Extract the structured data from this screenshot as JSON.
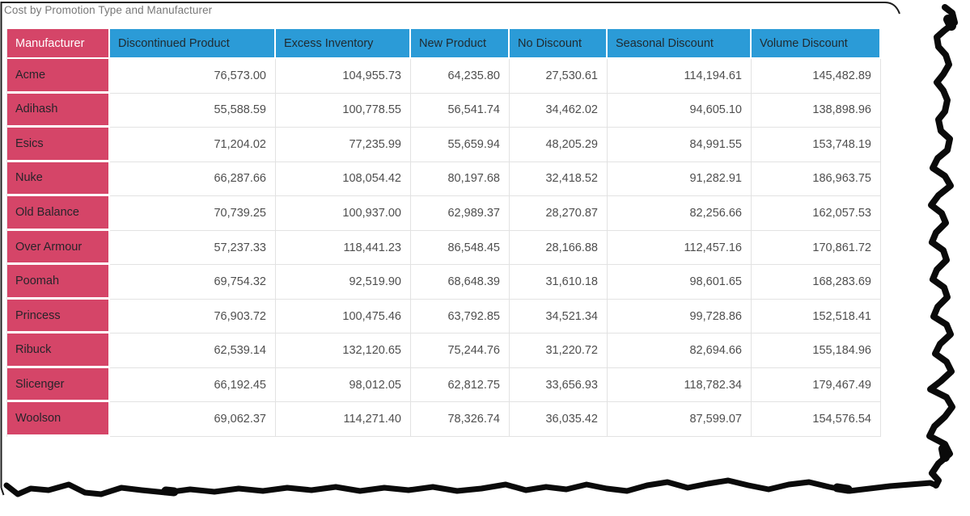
{
  "title": "Cost by Promotion Type and Manufacturer",
  "colors": {
    "header_pink": "#d54568",
    "header_blue": "#2b9bd7",
    "grid_line": "#e2e2e2",
    "title_text": "#787878",
    "value_text": "#4e4e4e",
    "torn_edge": "#0a0a0a"
  },
  "table": {
    "corner_header": "Manufacturer",
    "column_headers": [
      "Discontinued Product",
      "Excess Inventory",
      "New Product",
      "No Discount",
      "Seasonal Discount",
      "Volume Discount"
    ],
    "rows": [
      {
        "manufacturer": "Acme",
        "values": [
          "76,573.00",
          "104,955.73",
          "64,235.80",
          "27,530.61",
          "114,194.61",
          "145,482.89"
        ]
      },
      {
        "manufacturer": "Adihash",
        "values": [
          "55,588.59",
          "100,778.55",
          "56,541.74",
          "34,462.02",
          "94,605.10",
          "138,898.96"
        ]
      },
      {
        "manufacturer": "Esics",
        "values": [
          "71,204.02",
          "77,235.99",
          "55,659.94",
          "48,205.29",
          "84,991.55",
          "153,748.19"
        ]
      },
      {
        "manufacturer": "Nuke",
        "values": [
          "66,287.66",
          "108,054.42",
          "80,197.68",
          "32,418.52",
          "91,282.91",
          "186,963.75"
        ]
      },
      {
        "manufacturer": "Old Balance",
        "values": [
          "70,739.25",
          "100,937.00",
          "62,989.37",
          "28,270.87",
          "82,256.66",
          "162,057.53"
        ]
      },
      {
        "manufacturer": "Over Armour",
        "values": [
          "57,237.33",
          "118,441.23",
          "86,548.45",
          "28,166.88",
          "112,457.16",
          "170,861.72"
        ]
      },
      {
        "manufacturer": "Poomah",
        "values": [
          "69,754.32",
          "92,519.90",
          "68,648.39",
          "31,610.18",
          "98,601.65",
          "168,283.69"
        ]
      },
      {
        "manufacturer": "Princess",
        "values": [
          "76,903.72",
          "100,475.46",
          "63,792.85",
          "34,521.34",
          "99,728.86",
          "152,518.41"
        ]
      },
      {
        "manufacturer": "Ribuck",
        "values": [
          "62,539.14",
          "132,120.65",
          "75,244.76",
          "31,220.72",
          "82,694.66",
          "155,184.96"
        ]
      },
      {
        "manufacturer": "Slicenger",
        "values": [
          "66,192.45",
          "98,012.05",
          "62,812.75",
          "33,656.93",
          "118,782.34",
          "179,467.49"
        ]
      },
      {
        "manufacturer": "Woolson",
        "values": [
          "69,062.37",
          "114,271.40",
          "78,326.74",
          "36,035.42",
          "87,599.07",
          "154,576.54"
        ]
      }
    ]
  },
  "chart_data": {
    "type": "table",
    "title": "Cost by Promotion Type and Manufacturer",
    "row_field": "Manufacturer",
    "columns": [
      "Discontinued Product",
      "Excess Inventory",
      "New Product",
      "No Discount",
      "Seasonal Discount",
      "Volume Discount"
    ],
    "rows": [
      "Acme",
      "Adihash",
      "Esics",
      "Nuke",
      "Old Balance",
      "Over Armour",
      "Poomah",
      "Princess",
      "Ribuck",
      "Slicenger",
      "Woolson"
    ],
    "values": [
      [
        76573.0,
        104955.73,
        64235.8,
        27530.61,
        114194.61,
        145482.89
      ],
      [
        55588.59,
        100778.55,
        56541.74,
        34462.02,
        94605.1,
        138898.96
      ],
      [
        71204.02,
        77235.99,
        55659.94,
        48205.29,
        84991.55,
        153748.19
      ],
      [
        66287.66,
        108054.42,
        80197.68,
        32418.52,
        91282.91,
        186963.75
      ],
      [
        70739.25,
        100937.0,
        62989.37,
        28270.87,
        82256.66,
        162057.53
      ],
      [
        57237.33,
        118441.23,
        86548.45,
        28166.88,
        112457.16,
        170861.72
      ],
      [
        69754.32,
        92519.9,
        68648.39,
        31610.18,
        98601.65,
        168283.69
      ],
      [
        76903.72,
        100475.46,
        63792.85,
        34521.34,
        99728.86,
        152518.41
      ],
      [
        62539.14,
        132120.65,
        75244.76,
        31220.72,
        82694.66,
        155184.96
      ],
      [
        66192.45,
        98012.05,
        62812.75,
        33656.93,
        118782.34,
        179467.49
      ],
      [
        69062.37,
        114271.4,
        78326.74,
        36035.42,
        87599.07,
        154576.54
      ]
    ]
  }
}
